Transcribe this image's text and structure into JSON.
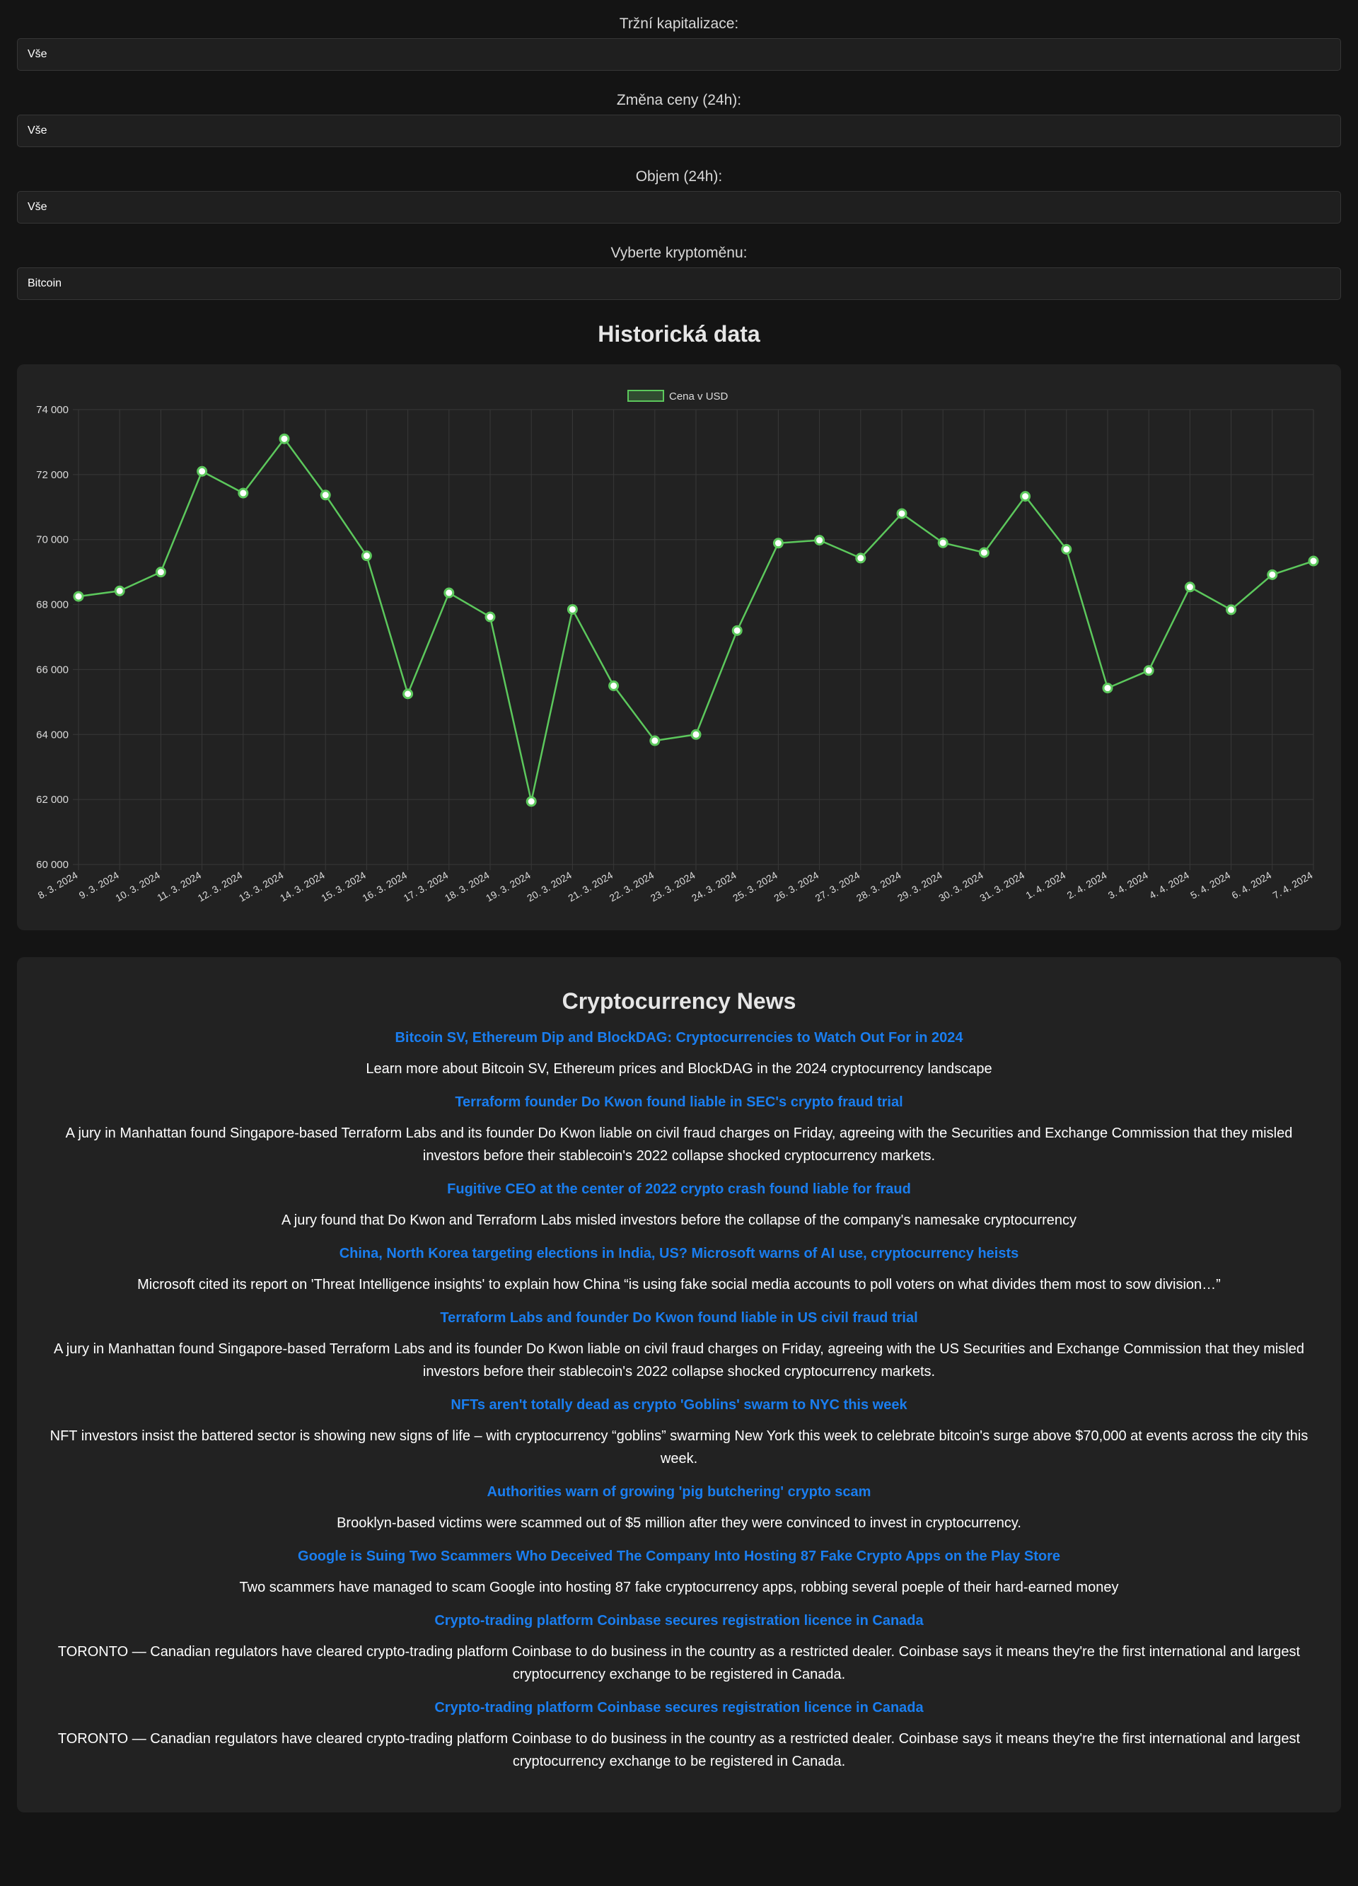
{
  "filters": [
    {
      "label": "Tržní kapitalizace:",
      "value": "Vše"
    },
    {
      "label": "Změna ceny (24h):",
      "value": "Vše"
    },
    {
      "label": "Objem (24h):",
      "value": "Vše"
    },
    {
      "label": "Vyberte kryptoměnu:",
      "value": "Bitcoin"
    }
  ],
  "history": {
    "title": "Historická data"
  },
  "colors": {
    "line": "#5cc85c",
    "background": "#141414",
    "card": "#222222",
    "link": "#1a7ef0"
  },
  "chart_data": {
    "type": "line",
    "legend": "top",
    "grid": true,
    "x": [
      "8. 3. 2024",
      "9. 3. 2024",
      "10. 3. 2024",
      "11. 3. 2024",
      "12. 3. 2024",
      "13. 3. 2024",
      "14. 3. 2024",
      "15. 3. 2024",
      "16. 3. 2024",
      "17. 3. 2024",
      "18. 3. 2024",
      "19. 3. 2024",
      "20. 3. 2024",
      "21. 3. 2024",
      "22. 3. 2024",
      "23. 3. 2024",
      "24. 3. 2024",
      "25. 3. 2024",
      "26. 3. 2024",
      "27. 3. 2024",
      "28. 3. 2024",
      "29. 3. 2024",
      "30. 3. 2024",
      "31. 3. 2024",
      "1. 4. 2024",
      "2. 4. 2024",
      "3. 4. 2024",
      "4. 4. 2024",
      "5. 4. 2024",
      "6. 4. 2024",
      "7. 4. 2024"
    ],
    "series": [
      {
        "name": "Cena v USD",
        "values": [
          68250,
          68420,
          69000,
          72100,
          71430,
          73100,
          71370,
          69500,
          65250,
          68360,
          67620,
          61940,
          67850,
          65500,
          63810,
          64000,
          67200,
          69890,
          69980,
          69430,
          70800,
          69900,
          69600,
          71330,
          69700,
          65430,
          65970,
          68540,
          67840,
          68920,
          69340
        ]
      }
    ],
    "ylim": [
      60000,
      74000
    ],
    "yticks": [
      "74 000",
      "72 000",
      "70 000",
      "68 000",
      "66 000",
      "64 000",
      "62 000",
      "60 000"
    ]
  },
  "news": {
    "title": "Cryptocurrency News",
    "items": [
      {
        "title": "Bitcoin SV, Ethereum Dip and BlockDAG: Cryptocurrencies to Watch Out For in 2024",
        "description": "Learn more about Bitcoin SV, Ethereum prices and BlockDAG in the 2024 cryptocurrency landscape"
      },
      {
        "title": "Terraform founder Do Kwon found liable in SEC's crypto fraud trial",
        "description": "A jury in Manhattan found Singapore-based Terraform Labs and its founder Do Kwon liable on civil fraud charges on Friday, agreeing with the Securities and Exchange Commission that they misled investors before their stablecoin's 2022 collapse shocked cryptocurrency markets."
      },
      {
        "title": "Fugitive CEO at the center of 2022 crypto crash found liable for fraud",
        "description": "A jury found that Do Kwon and Terraform Labs misled investors before the collapse of the company's namesake cryptocurrency"
      },
      {
        "title": "China, North Korea targeting elections in India, US? Microsoft warns of AI use, cryptocurrency heists",
        "description": "Microsoft cited its report on 'Threat Intelligence insights' to explain how China “is using fake social media accounts to poll voters on what divides them most to sow division…”"
      },
      {
        "title": "Terraform Labs and founder Do Kwon found liable in US civil fraud trial",
        "description": "A jury in Manhattan found Singapore-based Terraform Labs and its founder Do Kwon liable on civil fraud charges on Friday, agreeing with the US Securities and Exchange Commission that they misled investors before their stablecoin's 2022 collapse shocked cryptocurrency markets."
      },
      {
        "title": "NFTs aren't totally dead as crypto 'Goblins' swarm to NYC this week",
        "description": "NFT investors insist the battered sector is showing new signs of life – with cryptocurrency “goblins” swarming New York this week to celebrate bitcoin's surge above $70,000 at events across the city this week."
      },
      {
        "title": "Authorities warn of growing 'pig butchering' crypto scam",
        "description": "Brooklyn-based victims were scammed out of $5 million after they were convinced to invest in cryptocurrency."
      },
      {
        "title": "Google is Suing Two Scammers Who Deceived The Company Into Hosting 87 Fake Crypto Apps on the Play Store",
        "description": "Two scammers have managed to scam Google into hosting 87 fake cryptocurrency apps, robbing several poeple of their hard-earned money"
      },
      {
        "title": "Crypto-trading platform Coinbase secures registration licence in Canada",
        "description": "TORONTO — Canadian regulators have cleared crypto-trading platform Coinbase to do business in the country as a restricted dealer. Coinbase says it means they're the first international and largest cryptocurrency exchange to be registered in Canada."
      },
      {
        "title": "Crypto-trading platform Coinbase secures registration licence in Canada",
        "description": "TORONTO — Canadian regulators have cleared crypto-trading platform Coinbase to do business in the country as a restricted dealer. Coinbase says it means they're the first international and largest cryptocurrency exchange to be registered in Canada."
      }
    ]
  }
}
